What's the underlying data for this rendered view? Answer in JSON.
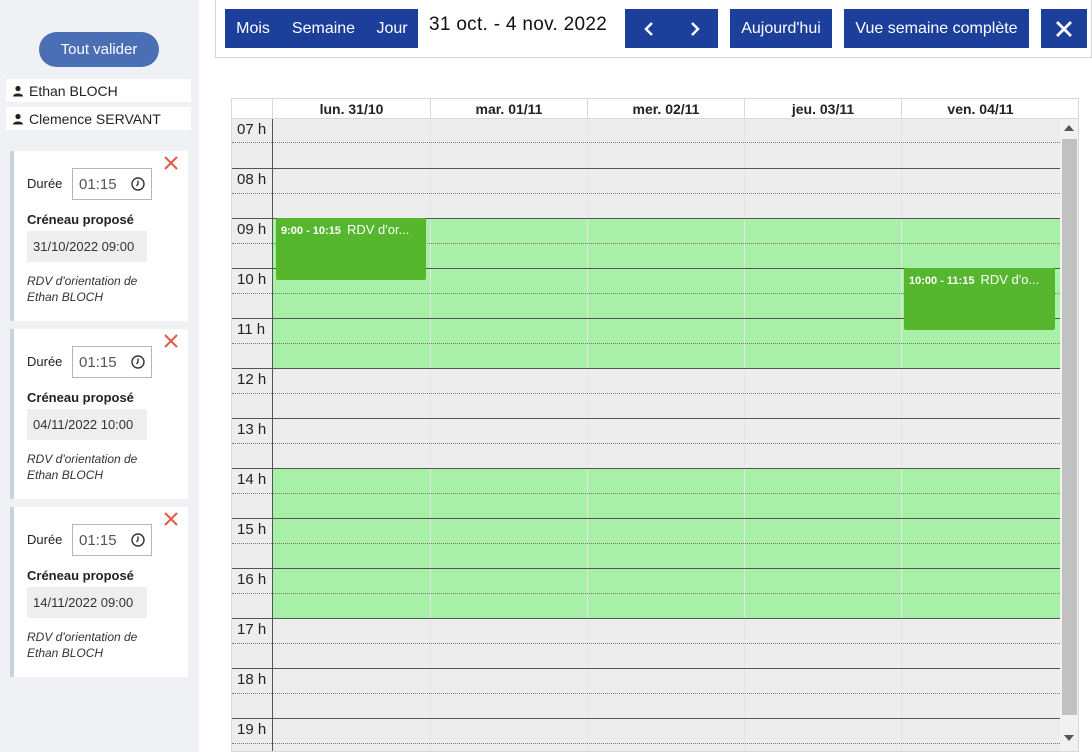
{
  "sidebar": {
    "validate_all": "Tout valider",
    "people": [
      "Ethan BLOCH",
      "Clemence SERVANT"
    ],
    "proposals": [
      {
        "duration_label": "Durée",
        "duration": "01:15",
        "slot_label": "Créneau proposé",
        "slot": "31/10/2022 09:00",
        "desc1": "RDV d'orientation de",
        "desc2": "Ethan BLOCH"
      },
      {
        "duration_label": "Durée",
        "duration": "01:15",
        "slot_label": "Créneau proposé",
        "slot": "04/11/2022 10:00",
        "desc1": "RDV d'orientation de",
        "desc2": "Ethan BLOCH"
      },
      {
        "duration_label": "Durée",
        "duration": "01:15",
        "slot_label": "Créneau proposé",
        "slot": "14/11/2022 09:00",
        "desc1": "RDV d'orientation de",
        "desc2": "Ethan BLOCH"
      }
    ]
  },
  "toolbar": {
    "month": "Mois",
    "week": "Semaine",
    "day": "Jour",
    "range": "31 oct. - 4 nov. 2022",
    "today": "Aujourd'hui",
    "full_week": "Vue semaine complète"
  },
  "calendar": {
    "days": [
      "lun. 31/10",
      "mar. 01/11",
      "mer. 02/11",
      "jeu. 03/11",
      "ven. 04/11"
    ],
    "hours": [
      "07 h",
      "08 h",
      "09 h",
      "10 h",
      "11 h",
      "12 h",
      "13 h",
      "14 h",
      "15 h",
      "16 h",
      "17 h",
      "18 h",
      "19 h"
    ],
    "events": [
      {
        "time": "9:00 - 10:15",
        "title": "RDV d'or..."
      },
      {
        "time": "10:00 - 11:15",
        "title": "RDV d'o..."
      }
    ]
  },
  "colors": {
    "primary": "#1b3f9b",
    "available": "#a8f0a8",
    "event": "#56b72f",
    "danger": "#e05a4a"
  }
}
